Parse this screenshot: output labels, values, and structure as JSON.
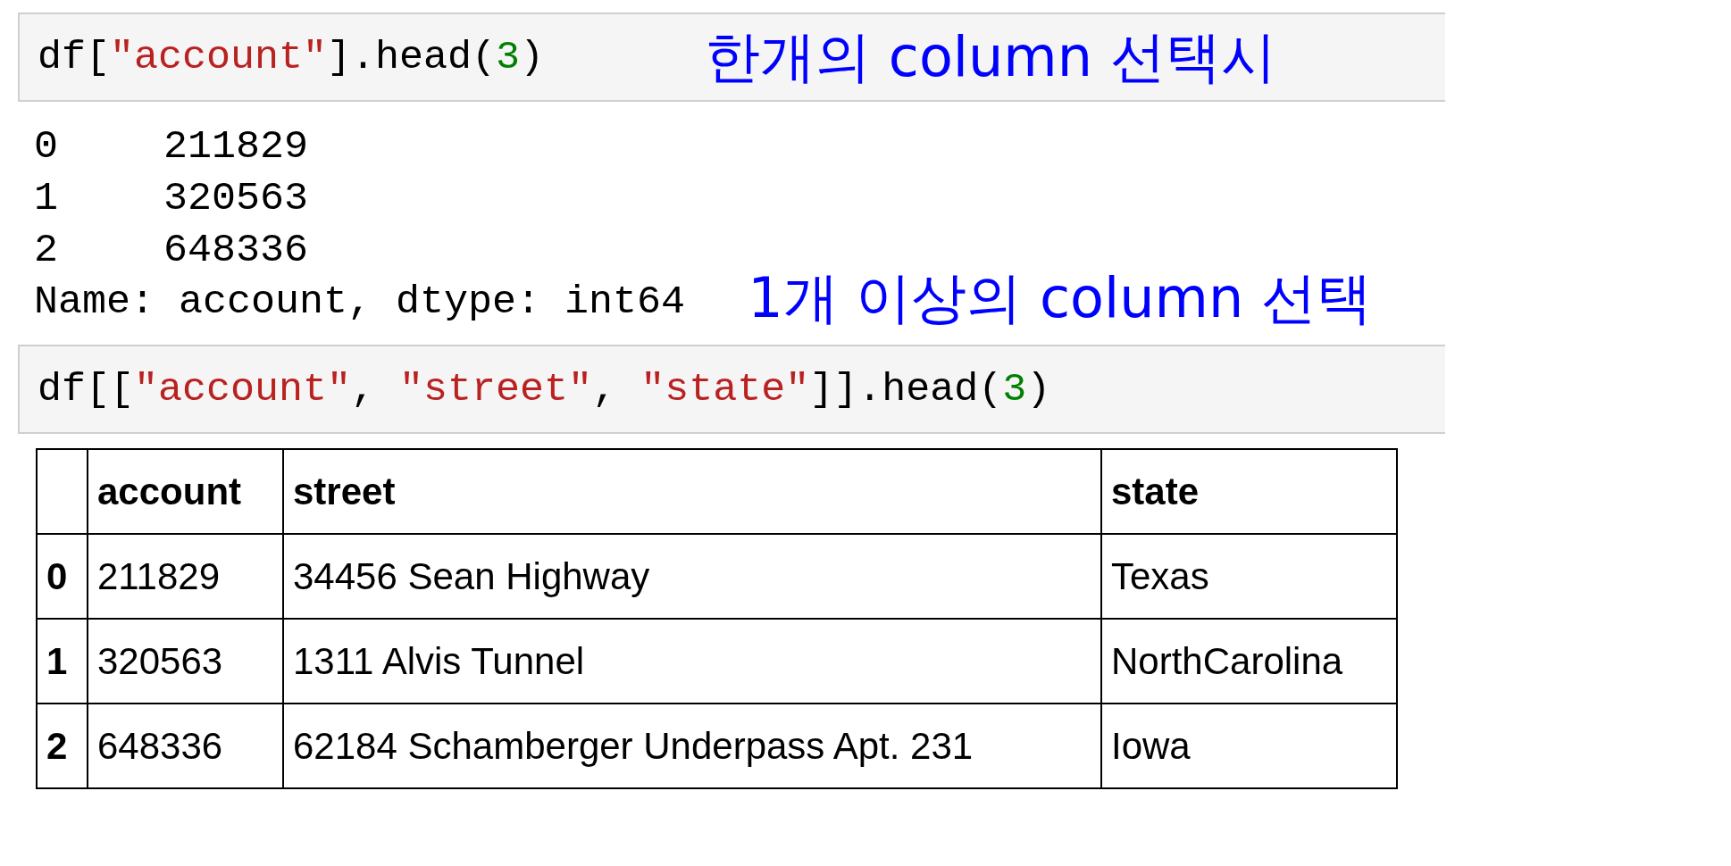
{
  "cells": [
    {
      "code": [
        {
          "kind": "plain",
          "text": "df["
        },
        {
          "kind": "string",
          "text": "\"account\""
        },
        {
          "kind": "plain",
          "text": "].head("
        },
        {
          "kind": "number",
          "text": "3"
        },
        {
          "kind": "plain",
          "text": ")"
        }
      ],
      "annotation": "한개의 column 선택시",
      "output": {
        "lines": [
          {
            "index": "0",
            "value": "211829"
          },
          {
            "index": "1",
            "value": "320563"
          },
          {
            "index": "2",
            "value": "648336"
          }
        ],
        "footer": "Name: account, dtype: int64",
        "note": "1개 이상의 column 선택"
      }
    },
    {
      "code": [
        {
          "kind": "plain",
          "text": "df[["
        },
        {
          "kind": "string",
          "text": "\"account\""
        },
        {
          "kind": "plain",
          "text": ", "
        },
        {
          "kind": "string",
          "text": "\"street\""
        },
        {
          "kind": "plain",
          "text": ", "
        },
        {
          "kind": "string",
          "text": "\"state\""
        },
        {
          "kind": "plain",
          "text": "]].head("
        },
        {
          "kind": "number",
          "text": "3"
        },
        {
          "kind": "plain",
          "text": ")"
        }
      ],
      "table": {
        "columns": [
          "",
          "account",
          "street",
          "state"
        ],
        "rows": [
          [
            "0",
            "211829",
            "34456 Sean Highway",
            "Texas"
          ],
          [
            "1",
            "320563",
            "1311 Alvis Tunnel",
            "NorthCarolina"
          ],
          [
            "2",
            "648336",
            "62184 Schamberger Underpass Apt. 231",
            "Iowa"
          ]
        ]
      }
    }
  ]
}
